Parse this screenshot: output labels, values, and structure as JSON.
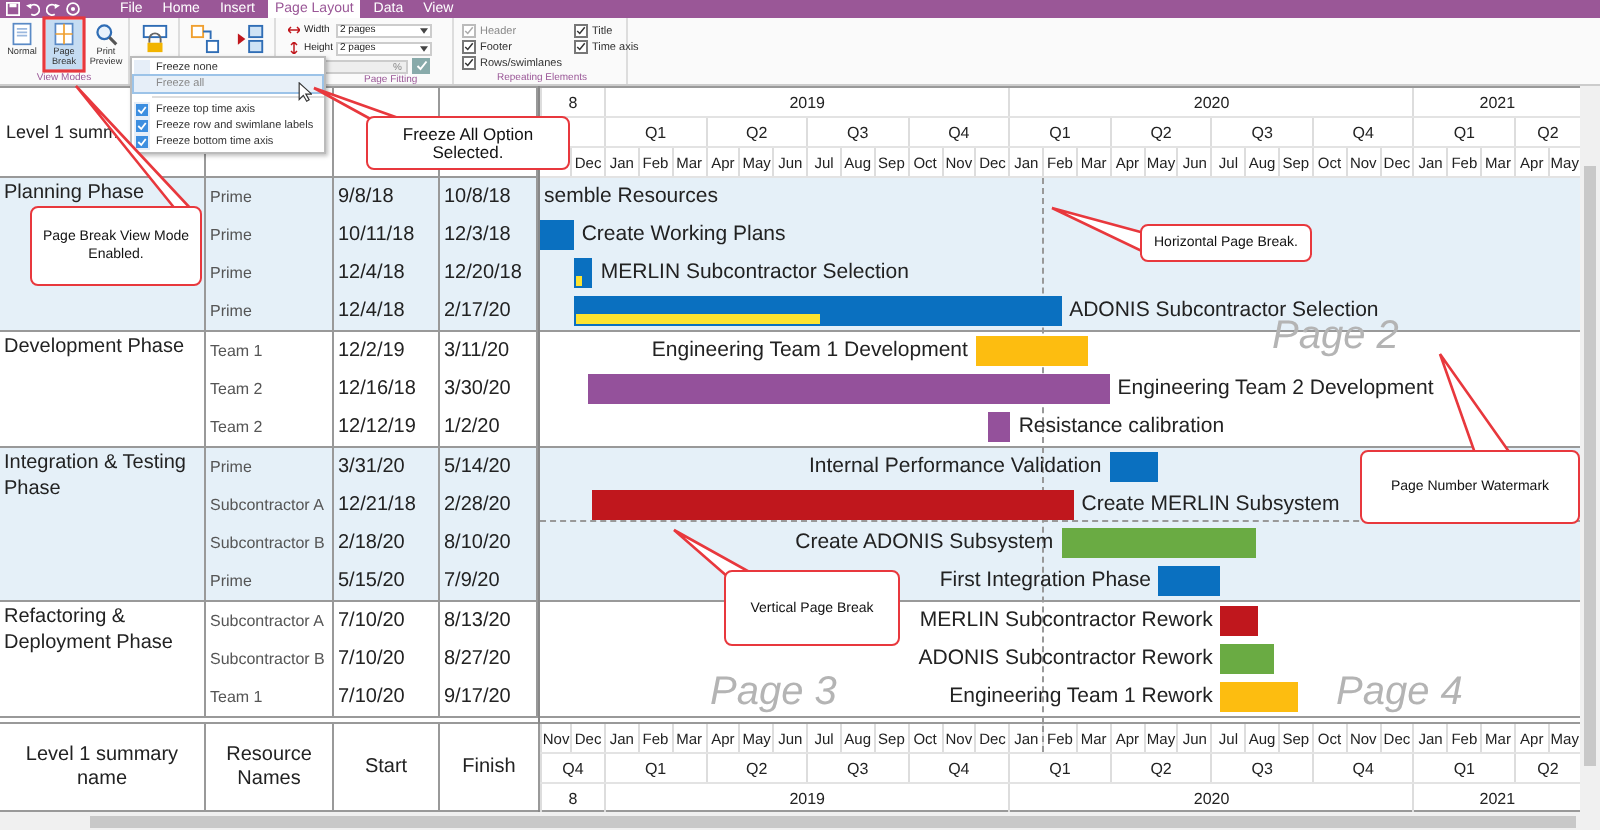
{
  "menu_bar": {
    "tabs": [
      {
        "label": "File",
        "selected": false
      },
      {
        "label": "Home",
        "selected": false
      },
      {
        "label": "Insert",
        "selected": false
      },
      {
        "label": "Page Layout",
        "selected": true
      },
      {
        "label": "Data",
        "selected": false
      },
      {
        "label": "View",
        "selected": false
      }
    ]
  },
  "ribbon": {
    "view_modes": {
      "label": "View Modes",
      "buttons": [
        {
          "label": "Normal",
          "selected": false
        },
        {
          "label": "Page Break",
          "selected": true
        },
        {
          "label": "Print Preview",
          "selected": false
        }
      ]
    },
    "page_fitting": {
      "label": "Page Fitting",
      "width_label": "Width",
      "width_value": "2 pages",
      "height_label": "Height",
      "height_value": "2 pages",
      "zoom_value": "%",
      "zoom_disabled": true
    },
    "repeating_elements": {
      "label": "Repeating Elements",
      "options": [
        {
          "label": "Header",
          "checked": true,
          "disabled": true
        },
        {
          "label": "Title",
          "checked": true,
          "disabled": false
        },
        {
          "label": "Footer",
          "checked": true,
          "disabled": false
        },
        {
          "label": "Time axis",
          "checked": true,
          "disabled": false
        },
        {
          "label": "Rows/swimlanes",
          "checked": true,
          "disabled": false
        }
      ]
    }
  },
  "freeze_menu": {
    "items": [
      {
        "label": "Freeze none",
        "checked": false,
        "selected": false,
        "disabled": false
      },
      {
        "label": "Freeze all",
        "checked": false,
        "selected": true,
        "disabled": true
      },
      {
        "label": "Freeze top time axis",
        "checked": true,
        "selected": false,
        "disabled": false
      },
      {
        "label": "Freeze row and swimlane labels",
        "checked": true,
        "selected": false,
        "disabled": false
      },
      {
        "label": "Freeze bottom time axis",
        "checked": true,
        "selected": false,
        "disabled": false
      }
    ]
  },
  "table": {
    "top_header": "Level 1 summ",
    "bottom_header": [
      "Level 1 summary name",
      "Resource Names",
      "Start",
      "Finish"
    ],
    "groups": [
      {
        "name": "Planning Phase",
        "shaded": true,
        "rows": [
          {
            "resource": "Prime",
            "start": "9/8/18",
            "finish": "10/8/18",
            "task": {
              "name": "semble Resources",
              "label_left": false
            }
          },
          {
            "resource": "Prime",
            "start": "10/11/18",
            "finish": "12/3/18",
            "task": {
              "name": "Create Working Plans",
              "color": "#0a70c0",
              "label_left": false
            }
          },
          {
            "resource": "Prime",
            "start": "12/4/18",
            "finish": "12/20/18",
            "task": {
              "name": "MERLIN Subcontractor Selection",
              "color": "#0a70c0",
              "label_left": false,
              "level": 0.35
            }
          },
          {
            "resource": "Prime",
            "start": "12/4/18",
            "finish": "2/17/20",
            "task": {
              "name": "ADONIS Subcontractor Selection",
              "color": "#0a70c0",
              "label_left": false,
              "level": 0.5
            }
          }
        ]
      },
      {
        "name": "Development Phase",
        "shaded": false,
        "rows": [
          {
            "resource": "Team 1",
            "start": "12/2/19",
            "finish": "3/11/20",
            "task": {
              "name": "Engineering Team 1 Development",
              "color": "#fdbd10",
              "label_left": true
            }
          },
          {
            "resource": "Team 2",
            "start": "12/16/18",
            "finish": "3/30/20",
            "task": {
              "name": "Engineering Team 2 Development",
              "color": "#94519b",
              "label_left": false
            }
          },
          {
            "resource": "Team 2",
            "start": "12/12/19",
            "finish": "1/2/20",
            "task": {
              "name": "Resistance calibration",
              "color": "#94519b",
              "label_left": false
            }
          }
        ]
      },
      {
        "name": "Integration & Testing Phase",
        "shaded": true,
        "rows": [
          {
            "resource": "Prime",
            "start": "3/31/20",
            "finish": "5/14/20",
            "task": {
              "name": "Internal Performance Validation",
              "color": "#0a70c0",
              "label_left": true
            }
          },
          {
            "resource": "Subcontractor A",
            "start": "12/21/18",
            "finish": "2/28/20",
            "task": {
              "name": "Create MERLIN Subsystem",
              "color": "#c0171d",
              "label_left": false
            }
          },
          {
            "resource": "Subcontractor B",
            "start": "2/18/20",
            "finish": "8/10/20",
            "task": {
              "name": "Create ADONIS Subsystem",
              "color": "#6aab43",
              "label_left": true
            }
          },
          {
            "resource": "Prime",
            "start": "5/15/20",
            "finish": "7/9/20",
            "task": {
              "name": "First Integration Phase",
              "color": "#0a70c0",
              "label_left": true
            }
          }
        ]
      },
      {
        "name": "Refactoring & Deployment Phase",
        "shaded": false,
        "rows": [
          {
            "resource": "Subcontractor A",
            "start": "7/10/20",
            "finish": "8/13/20",
            "task": {
              "name": "MERLIN Subcontractor Rework",
              "color": "#c0171d",
              "label_left": true
            }
          },
          {
            "resource": "Subcontractor B",
            "start": "7/10/20",
            "finish": "8/27/20",
            "task": {
              "name": "ADONIS Subcontractor Rework",
              "color": "#6aab43",
              "label_left": true
            }
          },
          {
            "resource": "Team 1",
            "start": "7/10/20",
            "finish": "9/17/20",
            "task": {
              "name": "Engineering Team 1 Rework",
              "color": "#fdbd10",
              "label_left": true
            }
          }
        ]
      }
    ]
  },
  "timeline": {
    "top": {
      "years": [
        "8",
        "2019",
        "2020",
        "2021"
      ],
      "quarters": [
        "Q1",
        "Q2",
        "Q3",
        "Q4",
        "Q1",
        "Q2",
        "Q3",
        "Q4",
        "Q1",
        "Q2"
      ],
      "months": [
        "Dec",
        "Jan",
        "Feb",
        "Mar",
        "Apr",
        "May",
        "Jun",
        "Jul",
        "Aug",
        "Sep",
        "Oct",
        "Nov",
        "Dec",
        "Jan",
        "Feb",
        "Mar",
        "Apr",
        "May",
        "Jun",
        "Jul",
        "Aug",
        "Sep",
        "Oct",
        "Nov",
        "Dec",
        "Jan",
        "Feb",
        "Mar",
        "Apr",
        "May"
      ]
    },
    "bottom": {
      "months": [
        "Nov",
        "Dec",
        "Jan",
        "Feb",
        "Mar",
        "Apr",
        "May",
        "Jun",
        "Jul",
        "Aug",
        "Sep",
        "Oct",
        "Nov",
        "Dec",
        "Jan",
        "Feb",
        "Mar",
        "Apr",
        "May",
        "Jun",
        "Jul",
        "Aug",
        "Sep",
        "Oct",
        "Nov",
        "Dec",
        "Jan",
        "Feb",
        "Mar",
        "Apr",
        "May"
      ],
      "quarters": [
        "Q4",
        "Q1",
        "Q2",
        "Q3",
        "Q4",
        "Q1",
        "Q2",
        "Q3",
        "Q4",
        "Q1",
        "Q2"
      ],
      "years": [
        "8",
        "2019",
        "2020",
        "2021"
      ]
    }
  },
  "watermarks": [
    "Page 2",
    "Page 3",
    "Page 4"
  ],
  "callouts": [
    "Page Break View Mode Enabled.",
    "Freeze All Option Selected.",
    "Horizontal Page Break.",
    "Page Number Watermark",
    "Vertical Page Break"
  ]
}
